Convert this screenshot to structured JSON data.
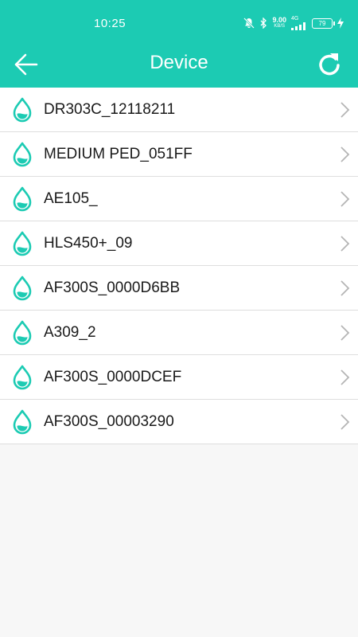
{
  "status_bar": {
    "time": "10:25",
    "net_speed_value": "9.00",
    "net_speed_unit": "KB/S",
    "network": "4G",
    "battery": "79"
  },
  "header": {
    "title": "Device",
    "back_icon": "arrow-left-icon",
    "refresh_icon": "refresh-icon"
  },
  "devices": [
    {
      "name": "DR303C_12118211"
    },
    {
      "name": "MEDIUM PED_051FF"
    },
    {
      "name": "AE105_"
    },
    {
      "name": "HLS450+_09"
    },
    {
      "name": "AF300S_0000D6BB"
    },
    {
      "name": "A309_2"
    },
    {
      "name": "AF300S_0000DCEF"
    },
    {
      "name": "AF300S_00003290"
    }
  ],
  "colors": {
    "accent": "#1ccbb3",
    "background": "#f7f7f7",
    "row_background": "#ffffff",
    "divider": "#dedede",
    "chevron": "#b5b5b5"
  }
}
